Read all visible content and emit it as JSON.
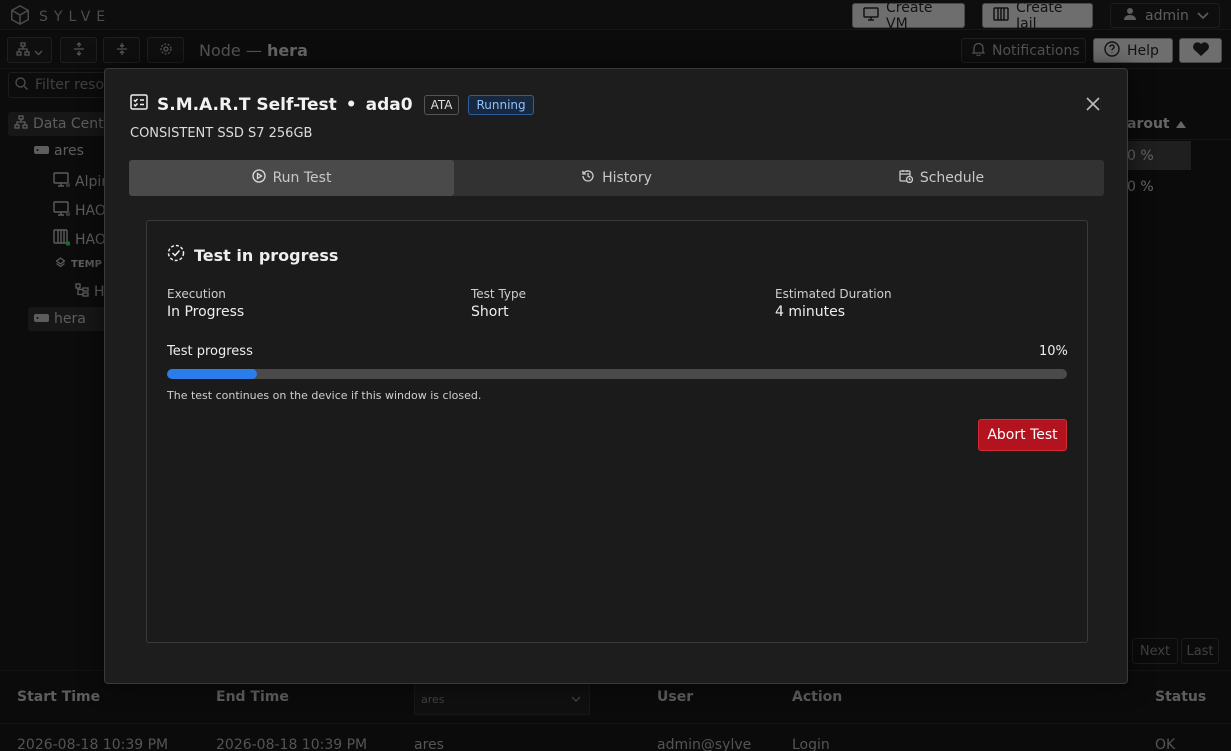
{
  "app": {
    "brand": "SYLVE",
    "create_vm_label": "Create VM",
    "create_jail_label": "Create Jail",
    "user_label": "admin"
  },
  "toolbar": {
    "node_prefix": "Node —",
    "node_name": "hera",
    "notifications_label": "Notifications",
    "help_label": "Help"
  },
  "sidebar": {
    "filter_placeholder": "Filter resou",
    "items": [
      {
        "label": "Data Cente",
        "icon": "datacenter-icon"
      },
      {
        "label": "ares",
        "icon": "server-icon"
      },
      {
        "label": "Alpin",
        "icon": "vm-icon"
      },
      {
        "label": "HAO",
        "icon": "vm-icon"
      },
      {
        "label": "HAO",
        "icon": "jail-icon"
      },
      {
        "label": "TEMP",
        "icon": "template-icon"
      },
      {
        "label": "H",
        "icon": "network-icon"
      },
      {
        "label": "hera",
        "icon": "server-icon"
      }
    ]
  },
  "background_table": {
    "sort_header": "arout",
    "rows": [
      "0 %",
      "0 %"
    ],
    "next_label": "Next",
    "last_label": "Last"
  },
  "audit_table": {
    "headers": [
      "Start Time",
      "End Time",
      "User",
      "Action",
      "Status"
    ],
    "node_filter": "ares",
    "row": {
      "start": "2026-08-18 10:39 PM",
      "end": "2026-08-18 10:39 PM",
      "node": "ares",
      "user": "admin@sylve",
      "action": "Login",
      "status": "OK"
    }
  },
  "modal": {
    "title": "S.M.A.R.T Self-Test",
    "separator": "•",
    "device": "ada0",
    "type_badge": "ATA",
    "status_badge": "Running",
    "subtitle": "CONSISTENT SSD S7 256GB",
    "tabs": [
      {
        "label": "Run Test",
        "icon": "play-circle-icon"
      },
      {
        "label": "History",
        "icon": "history-icon"
      },
      {
        "label": "Schedule",
        "icon": "calendar-clock-icon"
      }
    ],
    "card": {
      "title": "Test in progress",
      "execution_label": "Execution",
      "execution_value": "In Progress",
      "test_type_label": "Test Type",
      "test_type_value": "Short",
      "duration_label": "Estimated Duration",
      "duration_value": "4 minutes",
      "progress_label": "Test progress",
      "progress_text": "10%",
      "progress_fraction": 0.1,
      "note": "The test continues on the device if this window is closed.",
      "abort_label": "Abort Test"
    }
  },
  "colors": {
    "accent": "#2b7de9",
    "danger": "#b3121f",
    "running_badge": "#8fc1ff"
  }
}
